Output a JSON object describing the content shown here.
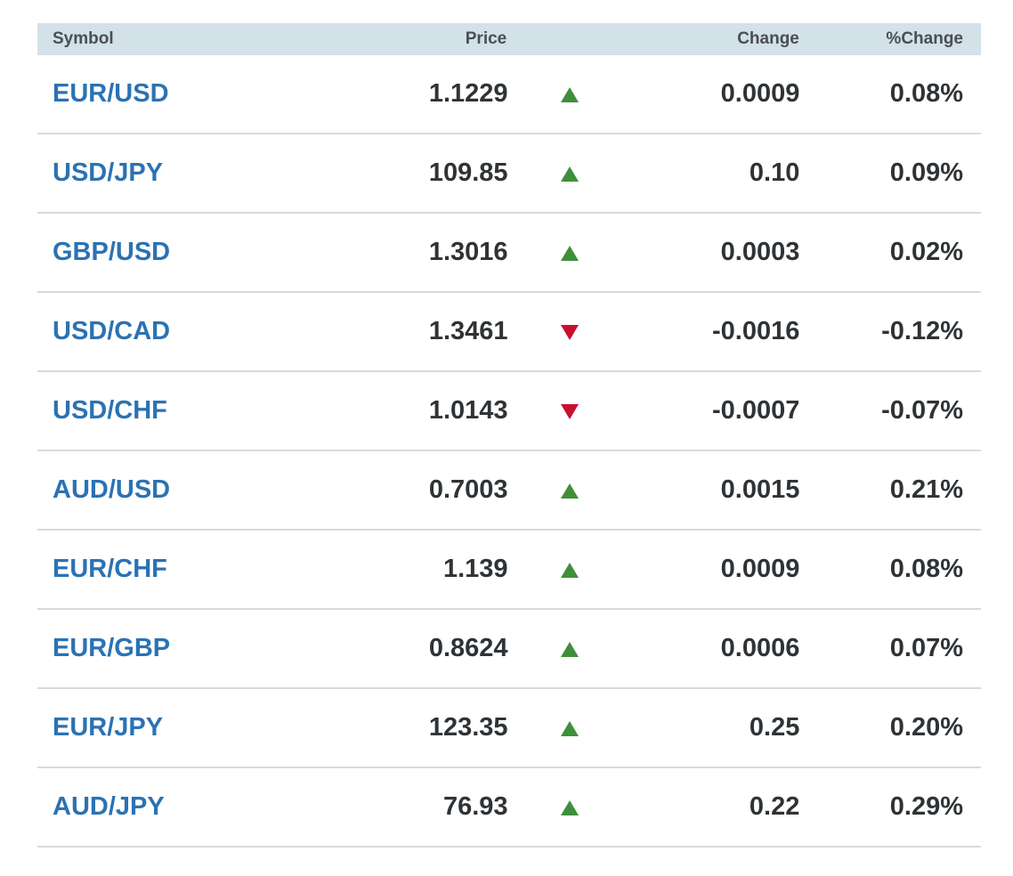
{
  "headers": {
    "symbol": "Symbol",
    "price": "Price",
    "change": "Change",
    "pct_change": "%Change"
  },
  "colors": {
    "up": "#3f8f3a",
    "down": "#c8102e",
    "link": "#2b72b3",
    "header_bg": "#d3e1e9"
  },
  "rows": [
    {
      "symbol": "EUR/USD",
      "price": "1.1229",
      "direction": "up",
      "change": "0.0009",
      "pct": "0.08%"
    },
    {
      "symbol": "USD/JPY",
      "price": "109.85",
      "direction": "up",
      "change": "0.10",
      "pct": "0.09%"
    },
    {
      "symbol": "GBP/USD",
      "price": "1.3016",
      "direction": "up",
      "change": "0.0003",
      "pct": "0.02%"
    },
    {
      "symbol": "USD/CAD",
      "price": "1.3461",
      "direction": "down",
      "change": "-0.0016",
      "pct": "-0.12%"
    },
    {
      "symbol": "USD/CHF",
      "price": "1.0143",
      "direction": "down",
      "change": "-0.0007",
      "pct": "-0.07%"
    },
    {
      "symbol": "AUD/USD",
      "price": "0.7003",
      "direction": "up",
      "change": "0.0015",
      "pct": "0.21%"
    },
    {
      "symbol": "EUR/CHF",
      "price": "1.139",
      "direction": "up",
      "change": "0.0009",
      "pct": "0.08%"
    },
    {
      "symbol": "EUR/GBP",
      "price": "0.8624",
      "direction": "up",
      "change": "0.0006",
      "pct": "0.07%"
    },
    {
      "symbol": "EUR/JPY",
      "price": "123.35",
      "direction": "up",
      "change": "0.25",
      "pct": "0.20%"
    },
    {
      "symbol": "AUD/JPY",
      "price": "76.93",
      "direction": "up",
      "change": "0.22",
      "pct": "0.29%"
    }
  ]
}
